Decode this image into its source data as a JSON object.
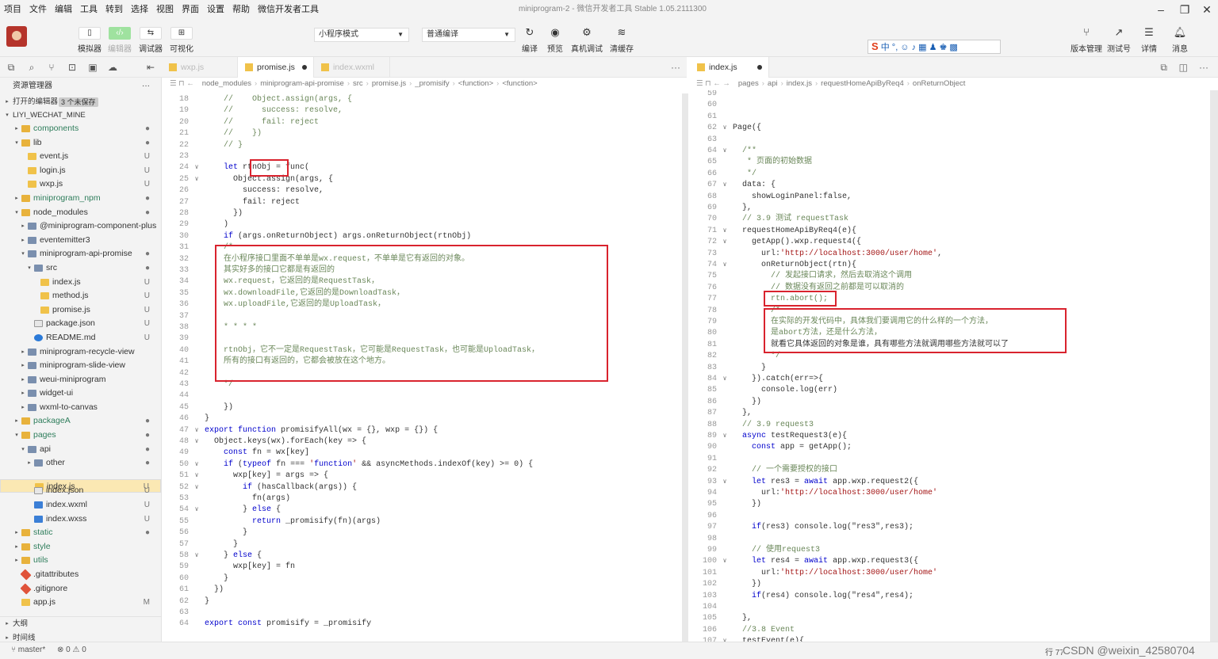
{
  "menu": [
    "项目",
    "文件",
    "编辑",
    "工具",
    "转到",
    "选择",
    "视图",
    "界面",
    "设置",
    "帮助",
    "微信开发者工具"
  ],
  "window_title": "miniprogram-2 - 微信开发者工具 Stable 1.05.2111300",
  "toolbar": {
    "buttons": [
      "模拟器",
      "编辑器",
      "调试器",
      "可视化"
    ],
    "mode_select": "小程序模式",
    "compile_select": "普通编译",
    "actions": [
      "编译",
      "预览",
      "真机调试",
      "清缓存"
    ],
    "right_actions": [
      "版本管理",
      "测试号",
      "详情",
      "消息"
    ],
    "ime_text": "中 °, ☺ ♪ ▦ ♟ ♚ ▩"
  },
  "explorer": {
    "title": "资源管理器",
    "open_editors": "打开的编辑器",
    "unsaved_badge": "3 个未保存",
    "root": "LIYI_WECHAT_MINE",
    "items": [
      {
        "name": "components",
        "depth": 1,
        "type": "folder",
        "arrow": "▸",
        "status": "●"
      },
      {
        "name": "lib",
        "depth": 1,
        "type": "folder",
        "arrow": "▾",
        "status": "●"
      },
      {
        "name": "event.js",
        "depth": 2,
        "type": "js",
        "arrow": "",
        "status": "U"
      },
      {
        "name": "login.js",
        "depth": 2,
        "type": "js",
        "arrow": "",
        "status": "U"
      },
      {
        "name": "wxp.js",
        "depth": 2,
        "type": "js",
        "arrow": "",
        "status": "U"
      },
      {
        "name": "miniprogram_npm",
        "depth": 1,
        "type": "folder",
        "arrow": "▸",
        "status": "●"
      },
      {
        "name": "node_modules",
        "depth": 1,
        "type": "folder",
        "arrow": "▾",
        "status": "●"
      },
      {
        "name": "@miniprogram-component-plus",
        "depth": 2,
        "type": "folder",
        "arrow": "▸",
        "status": ""
      },
      {
        "name": "eventemitter3",
        "depth": 2,
        "type": "folder",
        "arrow": "▸",
        "status": ""
      },
      {
        "name": "miniprogram-api-promise",
        "depth": 2,
        "type": "folder",
        "arrow": "▾",
        "status": "●"
      },
      {
        "name": "src",
        "depth": 3,
        "type": "folder",
        "arrow": "▾",
        "status": "●"
      },
      {
        "name": "index.js",
        "depth": 4,
        "type": "js",
        "arrow": "",
        "status": "U"
      },
      {
        "name": "method.js",
        "depth": 4,
        "type": "js",
        "arrow": "",
        "status": "U"
      },
      {
        "name": "promise.js",
        "depth": 4,
        "type": "js",
        "arrow": "",
        "status": "U"
      },
      {
        "name": "package.json",
        "depth": 3,
        "type": "json",
        "arrow": "",
        "status": "U"
      },
      {
        "name": "README.md",
        "depth": 3,
        "type": "md",
        "arrow": "",
        "status": "U"
      },
      {
        "name": "miniprogram-recycle-view",
        "depth": 2,
        "type": "folder",
        "arrow": "▸",
        "status": ""
      },
      {
        "name": "miniprogram-slide-view",
        "depth": 2,
        "type": "folder",
        "arrow": "▸",
        "status": ""
      },
      {
        "name": "weui-miniprogram",
        "depth": 2,
        "type": "folder",
        "arrow": "▸",
        "status": ""
      },
      {
        "name": "widget-ui",
        "depth": 2,
        "type": "folder",
        "arrow": "▸",
        "status": ""
      },
      {
        "name": "wxml-to-canvas",
        "depth": 2,
        "type": "folder",
        "arrow": "▸",
        "status": ""
      },
      {
        "name": "packageA",
        "depth": 1,
        "type": "folder",
        "arrow": "▸",
        "status": "●"
      },
      {
        "name": "pages",
        "depth": 1,
        "type": "folder",
        "arrow": "▾",
        "status": "●"
      },
      {
        "name": "api",
        "depth": 2,
        "type": "folder",
        "arrow": "▾",
        "status": "●"
      },
      {
        "name": "other",
        "depth": 3,
        "type": "folder",
        "arrow": "▸",
        "status": "●"
      },
      {
        "name": "index.js",
        "depth": 3,
        "type": "js",
        "arrow": "",
        "status": "U",
        "selected": true
      },
      {
        "name": "index.json",
        "depth": 3,
        "type": "json",
        "arrow": "",
        "status": "U"
      },
      {
        "name": "index.wxml",
        "depth": 3,
        "type": "wx",
        "arrow": "",
        "status": "U"
      },
      {
        "name": "index.wxss",
        "depth": 3,
        "type": "wx",
        "arrow": "",
        "status": "U"
      },
      {
        "name": "static",
        "depth": 1,
        "type": "folder",
        "arrow": "▸",
        "status": "●"
      },
      {
        "name": "style",
        "depth": 1,
        "type": "folder",
        "arrow": "▸",
        "status": ""
      },
      {
        "name": "utils",
        "depth": 1,
        "type": "folder",
        "arrow": "▸",
        "status": ""
      },
      {
        "name": ".gitattributes",
        "depth": 1,
        "type": "git",
        "arrow": "",
        "status": ""
      },
      {
        "name": ".gitignore",
        "depth": 1,
        "type": "git",
        "arrow": "",
        "status": ""
      },
      {
        "name": "app.js",
        "depth": 1,
        "type": "js",
        "arrow": "",
        "status": "M"
      }
    ],
    "outline": "大纲",
    "timeline": "时间线"
  },
  "left_editor": {
    "tabs": [
      {
        "label": "wxp.js",
        "active": false,
        "dirty": false
      },
      {
        "label": "promise.js",
        "active": true,
        "dirty": true
      },
      {
        "label": "index.wxml",
        "active": false,
        "dirty": false
      }
    ],
    "breadcrumb": [
      "node_modules",
      "miniprogram-api-promise",
      "src",
      "promise.js",
      "_promisify",
      "<function>",
      "<function>"
    ],
    "lines": [
      {
        "n": "18",
        "f": "",
        "t": "    //    Object.assign(args, {"
      },
      {
        "n": "19",
        "f": "",
        "t": "    //      success: resolve,"
      },
      {
        "n": "20",
        "f": "",
        "t": "    //      fail: reject"
      },
      {
        "n": "21",
        "f": "",
        "t": "    //    })"
      },
      {
        "n": "22",
        "f": "",
        "t": "    // }"
      },
      {
        "n": "23",
        "f": "",
        "t": ""
      },
      {
        "n": "24",
        "f": "∨",
        "t": "    let rtnObj = func("
      },
      {
        "n": "25",
        "f": "∨",
        "t": "      Object.assign(args, {"
      },
      {
        "n": "26",
        "f": "",
        "t": "        success: resolve,"
      },
      {
        "n": "27",
        "f": "",
        "t": "        fail: reject"
      },
      {
        "n": "28",
        "f": "",
        "t": "      })"
      },
      {
        "n": "29",
        "f": "",
        "t": "    )"
      },
      {
        "n": "30",
        "f": "",
        "t": "    if (args.onReturnObject) args.onReturnObject(rtnObj)"
      },
      {
        "n": "31",
        "f": "",
        "t": "    /*"
      },
      {
        "n": "32",
        "f": "",
        "t": "    在小程序接口里面不单单是wx.request，不单单是它有返回的对象。"
      },
      {
        "n": "33",
        "f": "",
        "t": "    其实好多的接口它都是有返回的"
      },
      {
        "n": "34",
        "f": "",
        "t": "    wx.request，它返回的是RequestTask，"
      },
      {
        "n": "35",
        "f": "",
        "t": "    wx.downloadFile,它返回的是DownloadTask，"
      },
      {
        "n": "36",
        "f": "",
        "t": "    wx.uploadFile,它返回的是UploadTask，"
      },
      {
        "n": "37",
        "f": "",
        "t": ""
      },
      {
        "n": "38",
        "f": "",
        "t": "    * * * *"
      },
      {
        "n": "39",
        "f": "",
        "t": ""
      },
      {
        "n": "40",
        "f": "",
        "t": "    rtnObj，它不一定是RequestTask，它可能是RequestTask，也可能是UploadTask，"
      },
      {
        "n": "41",
        "f": "",
        "t": "    所有的接口有返回的，它都会被放在这个地方。"
      },
      {
        "n": "42",
        "f": "",
        "t": ""
      },
      {
        "n": "43",
        "f": "",
        "t": "    */"
      },
      {
        "n": "44",
        "f": "",
        "t": ""
      },
      {
        "n": "45",
        "f": "",
        "t": "    })"
      },
      {
        "n": "46",
        "f": "",
        "t": "}"
      },
      {
        "n": "47",
        "f": "∨",
        "t": "export function promisifyAll(wx = {}, wxp = {}) {"
      },
      {
        "n": "48",
        "f": "∨",
        "t": "  Object.keys(wx).forEach(key => {"
      },
      {
        "n": "49",
        "f": "",
        "t": "    const fn = wx[key]"
      },
      {
        "n": "50",
        "f": "∨",
        "t": "    if (typeof fn === 'function' && asyncMethods.indexOf(key) >= 0) {"
      },
      {
        "n": "51",
        "f": "∨",
        "t": "      wxp[key] = args => {"
      },
      {
        "n": "52",
        "f": "∨",
        "t": "        if (hasCallback(args)) {"
      },
      {
        "n": "53",
        "f": "",
        "t": "          fn(args)"
      },
      {
        "n": "54",
        "f": "∨",
        "t": "        } else {"
      },
      {
        "n": "55",
        "f": "",
        "t": "          return _promisify(fn)(args)"
      },
      {
        "n": "56",
        "f": "",
        "t": "        }"
      },
      {
        "n": "57",
        "f": "",
        "t": "      }"
      },
      {
        "n": "58",
        "f": "∨",
        "t": "    } else {"
      },
      {
        "n": "59",
        "f": "",
        "t": "      wxp[key] = fn"
      },
      {
        "n": "60",
        "f": "",
        "t": "    }"
      },
      {
        "n": "61",
        "f": "",
        "t": "  })"
      },
      {
        "n": "62",
        "f": "",
        "t": "}"
      },
      {
        "n": "63",
        "f": "",
        "t": ""
      },
      {
        "n": "64",
        "f": "",
        "t": "export const promisify = _promisify"
      }
    ]
  },
  "right_editor": {
    "tabs": [
      {
        "label": "index.js",
        "active": true,
        "dirty": true
      }
    ],
    "breadcrumb": [
      "pages",
      "api",
      "index.js",
      "requestHomeApiByReq4",
      "onReturnObject"
    ],
    "lines": [
      {
        "n": "59",
        "f": "",
        "t": ""
      },
      {
        "n": "60",
        "f": "",
        "t": ""
      },
      {
        "n": "61",
        "f": "",
        "t": ""
      },
      {
        "n": "62",
        "f": "∨",
        "t": "Page({"
      },
      {
        "n": "63",
        "f": "",
        "t": ""
      },
      {
        "n": "64",
        "f": "∨",
        "t": "  /**"
      },
      {
        "n": "65",
        "f": "",
        "t": "   * 页面的初始数据"
      },
      {
        "n": "66",
        "f": "",
        "t": "   */"
      },
      {
        "n": "67",
        "f": "∨",
        "t": "  data: {"
      },
      {
        "n": "68",
        "f": "",
        "t": "    showLoginPanel:false,"
      },
      {
        "n": "69",
        "f": "",
        "t": "  },"
      },
      {
        "n": "70",
        "f": "",
        "t": "  // 3.9 测试 requestTask"
      },
      {
        "n": "71",
        "f": "∨",
        "t": "  requestHomeApiByReq4(e){"
      },
      {
        "n": "72",
        "f": "∨",
        "t": "    getApp().wxp.request4({"
      },
      {
        "n": "73",
        "f": "",
        "t": "      url:'http://localhost:3000/user/home',"
      },
      {
        "n": "74",
        "f": "∨",
        "t": "      onReturnObject(rtn){"
      },
      {
        "n": "75",
        "f": "",
        "t": "        // 发起接口请求，然后去取消这个调用"
      },
      {
        "n": "76",
        "f": "",
        "t": "        // 数据没有返回之前都是可以取消的"
      },
      {
        "n": "77",
        "f": "",
        "t": "        rtn.abort();"
      },
      {
        "n": "78",
        "f": "",
        "t": "        /*"
      },
      {
        "n": "79",
        "f": "",
        "t": "        在实际的开发代码中，具体我们要调用它的什么样的一个方法，"
      },
      {
        "n": "80",
        "f": "",
        "t": "        是abort方法，还是什么方法，"
      },
      {
        "n": "81",
        "f": "",
        "t": "        就看它具体返回的对象是谁，具有哪些方法就调用哪些方法就可以了"
      },
      {
        "n": "82",
        "f": "",
        "t": "        */"
      },
      {
        "n": "83",
        "f": "",
        "t": "      }"
      },
      {
        "n": "84",
        "f": "∨",
        "t": "    }).catch(err=>{"
      },
      {
        "n": "85",
        "f": "",
        "t": "      console.log(err)"
      },
      {
        "n": "86",
        "f": "",
        "t": "    })"
      },
      {
        "n": "87",
        "f": "",
        "t": "  },"
      },
      {
        "n": "88",
        "f": "",
        "t": "  // 3.9 request3"
      },
      {
        "n": "89",
        "f": "∨",
        "t": "  async testRequest3(e){"
      },
      {
        "n": "90",
        "f": "",
        "t": "    const app = getApp();"
      },
      {
        "n": "91",
        "f": "",
        "t": ""
      },
      {
        "n": "92",
        "f": "",
        "t": "    // 一个需要授权的接口"
      },
      {
        "n": "93",
        "f": "∨",
        "t": "    let res3 = await app.wxp.request2({"
      },
      {
        "n": "94",
        "f": "",
        "t": "      url:'http://localhost:3000/user/home'"
      },
      {
        "n": "95",
        "f": "",
        "t": "    })"
      },
      {
        "n": "96",
        "f": "",
        "t": ""
      },
      {
        "n": "97",
        "f": "",
        "t": "    if(res3) console.log(\"res3\",res3);"
      },
      {
        "n": "98",
        "f": "",
        "t": ""
      },
      {
        "n": "99",
        "f": "",
        "t": "    // 使用request3"
      },
      {
        "n": "100",
        "f": "∨",
        "t": "    let res4 = await app.wxp.request3({"
      },
      {
        "n": "101",
        "f": "",
        "t": "      url:'http://localhost:3000/user/home'"
      },
      {
        "n": "102",
        "f": "",
        "t": "    })"
      },
      {
        "n": "103",
        "f": "",
        "t": "    if(res4) console.log(\"res4\",res4);"
      },
      {
        "n": "104",
        "f": "",
        "t": ""
      },
      {
        "n": "105",
        "f": "",
        "t": "  },"
      },
      {
        "n": "106",
        "f": "",
        "t": "  //3.8 Event"
      },
      {
        "n": "107",
        "f": "∨",
        "t": "  testEvent(e){"
      }
    ]
  },
  "status": {
    "branch": "master*",
    "problems": "⊗ 0 ⚠ 0",
    "position": "行 77，列 23",
    "watermark": "CSDN @weixin_42580704"
  },
  "colors": {
    "highlight_box": "#d9232e",
    "selected_row": "#fbe8b3",
    "sim_button": "#9fe29f"
  }
}
